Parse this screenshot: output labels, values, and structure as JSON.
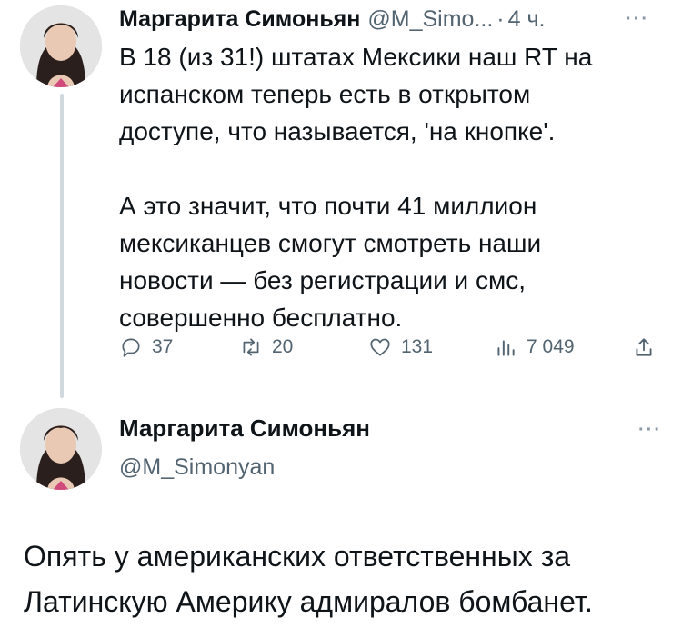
{
  "tweet1": {
    "author_name": "Маргарита Симоньян",
    "author_handle": "@M_Simo...",
    "separator": "·",
    "time": "4 ч.",
    "more": "···",
    "text": "В 18 (из 31!) штатах Мексики наш RT на\nиспанском теперь есть в открытом\nдоступе, что называется, 'на кнопке'.\n\nА это значит, что почти 41 миллион\nмексиканцев смогут смотреть наши\nновости — без регистрации и смс,\nсовершенно бесплатно.",
    "actions": {
      "replies": "37",
      "retweets": "20",
      "likes": "131",
      "views": "7 049"
    }
  },
  "tweet2": {
    "author_name": "Маргарита Симоньян",
    "author_handle": "@M_Simonyan",
    "more": "···",
    "text": "Опять у американских ответственных за\nЛатинскую Америку адмиралов бомбанет."
  },
  "icons": {
    "reply": "comment-bubble-icon",
    "retweet": "retweet-arrows-icon",
    "like": "heart-icon",
    "views": "bar-chart-icon",
    "share": "share-upload-icon"
  },
  "colors": {
    "text": "#0f1419",
    "secondary": "#536471",
    "thread_line": "#cfd9de"
  }
}
